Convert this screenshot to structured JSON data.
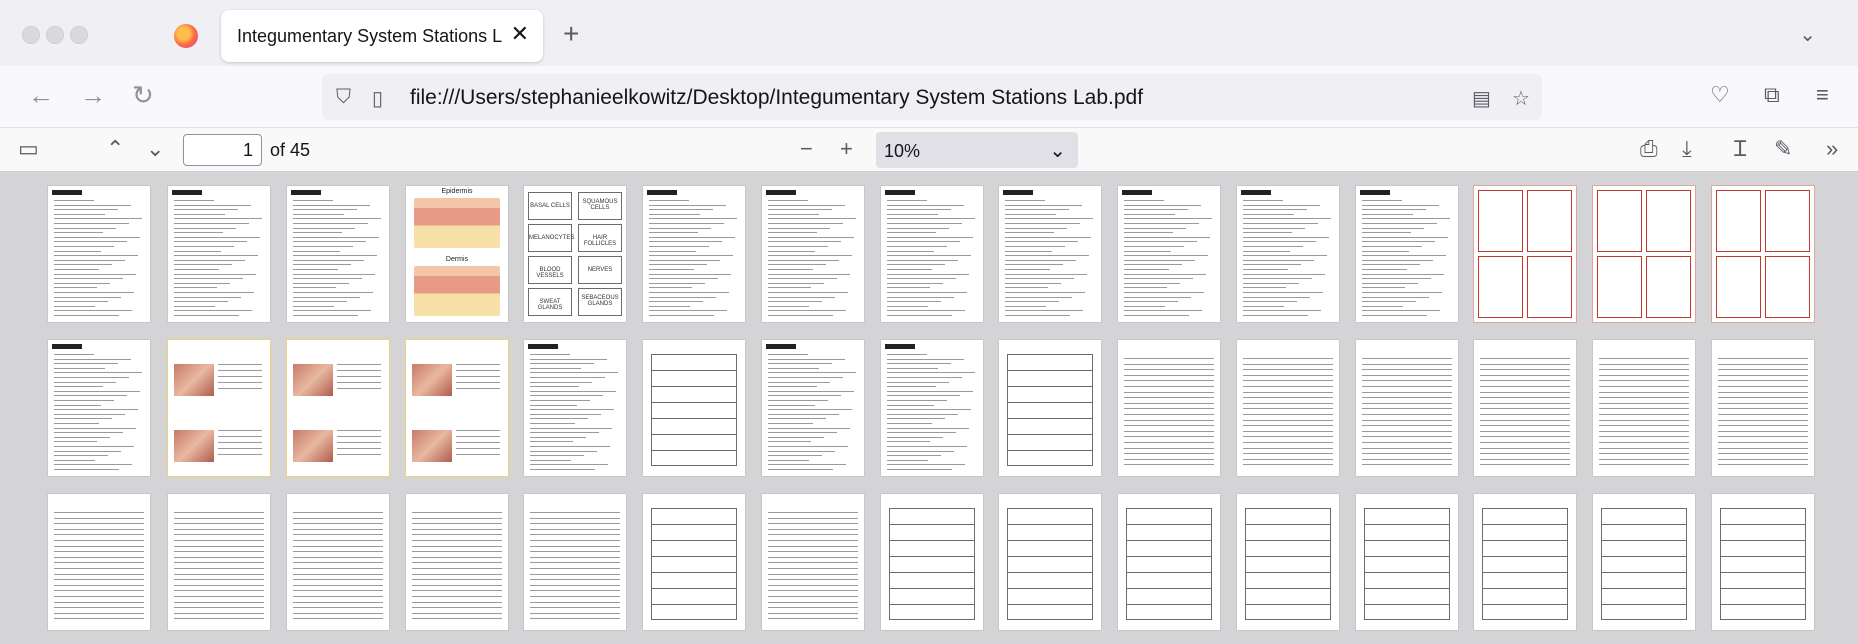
{
  "browser": {
    "tab_title": "Integumentary System Stations Lab.pdf",
    "url": "file:///Users/stephanieelkowitz/Desktop/Integumentary System Stations Lab.pdf",
    "icons": [
      "back-icon",
      "forward-icon",
      "reload-icon",
      "shield-icon",
      "file-icon",
      "reader-icon",
      "bookmark-star-icon",
      "pocket-icon",
      "extensions-icon",
      "menu-icon"
    ]
  },
  "pdf_toolbar": {
    "current_page": "1",
    "page_total_text": "of 45",
    "zoom": "10%",
    "icons": [
      "sidebar-toggle-icon",
      "previous-page-icon",
      "next-page-icon",
      "zoom-out-icon",
      "zoom-in-icon",
      "print-icon",
      "download-icon",
      "text-cursor-icon",
      "draw-icon",
      "more-tools-icon"
    ]
  },
  "thumbnails": {
    "row1": {
      "page4_labels": [
        "Epidermis",
        "Dermis"
      ],
      "page5_labels": [
        "BASAL CELLS",
        "SQUAMOUS CELLS",
        "MELANOCYTES",
        "HAIR FOLLICLES",
        "BLOOD VESSELS",
        "NERVES",
        "SWEAT GLANDS",
        "SEBACEOUS GLANDS"
      ]
    }
  }
}
